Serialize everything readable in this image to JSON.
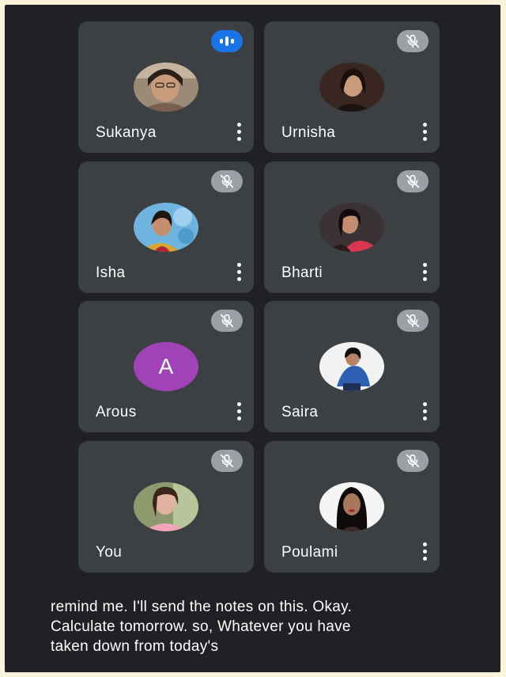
{
  "participants": [
    {
      "name": "Sukanya",
      "avatar_letter": "",
      "avatar_color": "#b9a48b",
      "mic": "speaking-indicator-icon"
    },
    {
      "name": "Urnisha",
      "avatar_letter": "",
      "avatar_color": "#4a2a1e",
      "mic": "mic-off-icon"
    },
    {
      "name": "Isha",
      "avatar_letter": "",
      "avatar_color": "#7ab3d8",
      "mic": "mic-off-icon"
    },
    {
      "name": "Bharti",
      "avatar_letter": "",
      "avatar_color": "#c43a4a",
      "mic": "mic-off-icon"
    },
    {
      "name": "Arous",
      "avatar_letter": "A",
      "avatar_color": "#a142b8",
      "mic": "mic-off-icon"
    },
    {
      "name": "Saira",
      "avatar_letter": "",
      "avatar_color": "#eaeaea",
      "mic": "mic-off-icon"
    },
    {
      "name": "You",
      "avatar_letter": "",
      "avatar_color": "#d9a3a0",
      "mic": "mic-off-icon"
    },
    {
      "name": "Poulami",
      "avatar_letter": "",
      "avatar_color": "#f4f4f4",
      "mic": "mic-off-icon"
    }
  ],
  "caption": {
    "lines": [
      "remind me. I'll send the notes on this. Okay.",
      "Calculate tomorrow. so, Whatever you have",
      "taken down from today's"
    ]
  },
  "colors": {
    "background": "#202124",
    "tile": "#3c4043",
    "speaking": "#1a73e8",
    "muted_badge": "#9aa0a6"
  }
}
